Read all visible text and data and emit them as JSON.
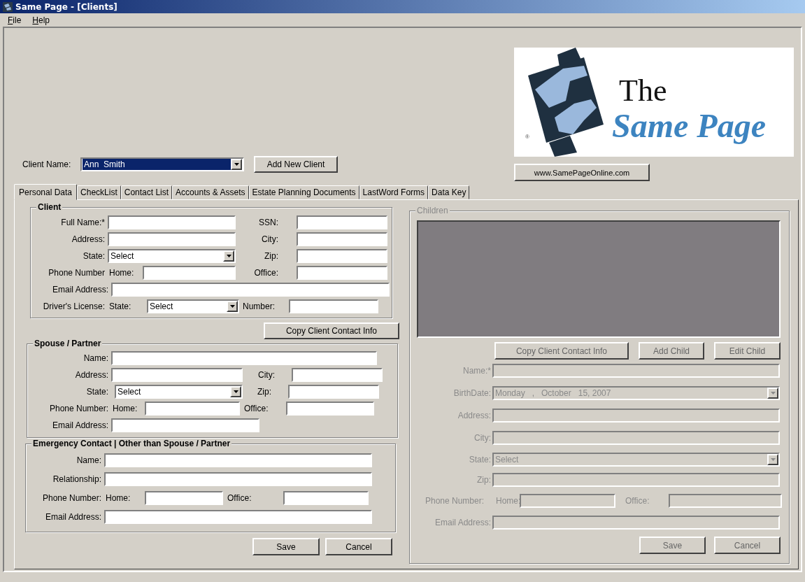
{
  "window": {
    "title": "Same Page - [Clients]"
  },
  "menu": [
    {
      "label": "File"
    },
    {
      "label": "Help"
    }
  ],
  "logo": {
    "line1": "The",
    "line2": "Same Page",
    "mark": "®"
  },
  "website_button": "www.SamePageOnline.com",
  "client_selector": {
    "label": "Client Name:",
    "value": "Ann  Smith",
    "highlighted": true
  },
  "add_client_button": "Add New Client",
  "tabs": [
    {
      "label": "Personal Data",
      "selected": true
    },
    {
      "label": "CheckList",
      "selected": false
    },
    {
      "label": "Contact List",
      "selected": false
    },
    {
      "label": "Accounts & Assets",
      "selected": false
    },
    {
      "label": "Estate Planning Documents",
      "selected": false
    },
    {
      "label": "LastWord Forms",
      "selected": false
    },
    {
      "label": "Data Key",
      "selected": false
    }
  ],
  "client": {
    "title": "Client",
    "full_name": "Full Name:*",
    "ssn": "SSN:",
    "address": "Address:",
    "city": "City:",
    "state": {
      "label": "State:",
      "value": "Select"
    },
    "zip": "Zip:",
    "phone_label": "Phone Number",
    "home": "Home:",
    "office": "Office:",
    "email": "Email Address:",
    "license_label": "Driver's License:",
    "license_state": {
      "label": "State:",
      "value": "Select"
    },
    "license_number": "Number:"
  },
  "copy_button": "Copy Client Contact Info",
  "spouse": {
    "title": "Spouse / Partner",
    "name": "Name:",
    "address": "Address:",
    "city": "City:",
    "state": {
      "label": "State:",
      "value": "Select"
    },
    "zip": "Zip:",
    "phone_label": "Phone Number:",
    "home": "Home:",
    "office": "Office:",
    "email": "Email Address:"
  },
  "emergency": {
    "title": "Emergency Contact | Other than Spouse / Partner",
    "name": "Name:",
    "relationship": "Relationship:",
    "phone_label": "Phone Number:",
    "home": "Home:",
    "office": "Office:",
    "email": "Email Address:"
  },
  "actions": [
    "Save",
    "Cancel"
  ],
  "children": {
    "title": "Children",
    "disabled": true,
    "buttons": [
      "Copy Client Contact Info",
      "Add Child",
      "Edit Child"
    ],
    "name": "Name:*",
    "birthdate": {
      "label": "BirthDate:",
      "value": "Monday   ,   October   15, 2007"
    },
    "address": "Address:",
    "city": "City:",
    "state": {
      "label": "State:",
      "value": "Select"
    },
    "zip": "Zip:",
    "phone_label": "Phone Number:",
    "home": "Home:",
    "office": "Office:",
    "email": "Email Address:",
    "actions": [
      "Save",
      "Cancel"
    ]
  }
}
